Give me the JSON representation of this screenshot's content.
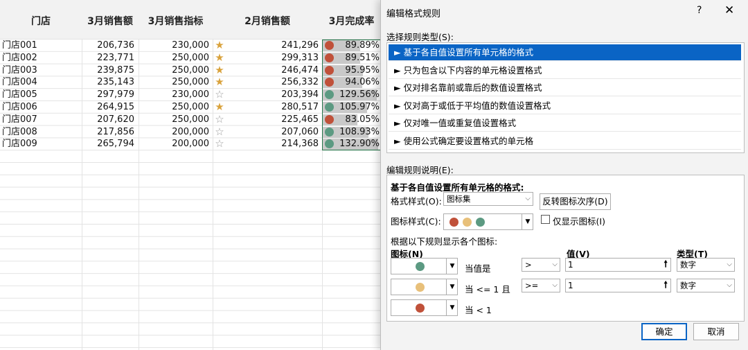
{
  "sheet": {
    "headers": {
      "store": "门店",
      "march_sales": "3月销售额",
      "march_target": "3月销售指标",
      "feb_sales": "2月销售额",
      "march_rate": "3月完成率"
    },
    "rows": [
      {
        "store": "门店001",
        "sales": "206,736",
        "target": "230,000",
        "star": "half",
        "feb": "241,296",
        "rate": "89.89%",
        "rate_value": 0.8989,
        "dot": "red"
      },
      {
        "store": "门店002",
        "sales": "223,771",
        "target": "250,000",
        "star": "full",
        "feb": "299,313",
        "rate": "89.51%",
        "rate_value": 0.8951,
        "dot": "red"
      },
      {
        "store": "门店003",
        "sales": "239,875",
        "target": "250,000",
        "star": "half",
        "feb": "246,474",
        "rate": "95.95%",
        "rate_value": 0.9595,
        "dot": "red"
      },
      {
        "store": "门店004",
        "sales": "235,143",
        "target": "250,000",
        "star": "half",
        "feb": "256,332",
        "rate": "94.06%",
        "rate_value": 0.9406,
        "dot": "red"
      },
      {
        "store": "门店005",
        "sales": "297,979",
        "target": "230,000",
        "star": "empty",
        "feb": "203,394",
        "rate": "129.56%",
        "rate_value": 1.2956,
        "dot": "green"
      },
      {
        "store": "门店006",
        "sales": "264,915",
        "target": "250,000",
        "star": "full",
        "feb": "280,517",
        "rate": "105.97%",
        "rate_value": 1.0597,
        "dot": "green"
      },
      {
        "store": "门店007",
        "sales": "207,620",
        "target": "250,000",
        "star": "empty",
        "feb": "225,465",
        "rate": "83.05%",
        "rate_value": 0.8305,
        "dot": "red"
      },
      {
        "store": "门店008",
        "sales": "217,856",
        "target": "200,000",
        "star": "empty",
        "feb": "207,060",
        "rate": "108.93%",
        "rate_value": 1.0893,
        "dot": "green"
      },
      {
        "store": "门店009",
        "sales": "265,794",
        "target": "200,000",
        "star": "empty",
        "feb": "214,368",
        "rate": "132.90%",
        "rate_value": 1.329,
        "dot": "green"
      }
    ]
  },
  "colors": {
    "red": "#c0513a",
    "yellow": "#e8c07a",
    "green": "#5c9a82",
    "star_gold": "#d9a23c",
    "selection": "#0a64c5"
  },
  "dialog": {
    "title": "编辑格式规则",
    "help": "?",
    "close": "✕",
    "select_rule_type_label": "选择规则类型(S):",
    "rule_types": [
      "► 基于各自值设置所有单元格的格式",
      "► 只为包含以下内容的单元格设置格式",
      "► 仅对排名靠前或靠后的数值设置格式",
      "► 仅对高于或低于平均值的数值设置格式",
      "► 仅对唯一值或重复值设置格式",
      "► 使用公式确定要设置格式的单元格"
    ],
    "edit_rule_desc_label": "编辑规则说明(E):",
    "desc_heading": "基于各自值设置所有单元格的格式:",
    "format_style_label": "格式样式(O):",
    "format_style_value": "图标集",
    "reverse_icon_order": "反转图标次序(D)",
    "icon_style_label": "图标样式(C):",
    "show_icon_only": "仅显示图标(I)",
    "rules_intro": "根据以下规则显示各个图标:",
    "col_icon": "图标(N)",
    "col_value": "值(V)",
    "col_type": "类型(T)",
    "icon_rules": [
      {
        "dot": "green",
        "cond": "当值是",
        "op": ">",
        "value": "1",
        "type": "数字"
      },
      {
        "dot": "yellow",
        "cond": "当 <= 1 且",
        "op": ">=",
        "value": "1",
        "type": "数字"
      },
      {
        "dot": "red",
        "cond": "当 < 1"
      }
    ],
    "ok": "确定",
    "cancel": "取消"
  }
}
